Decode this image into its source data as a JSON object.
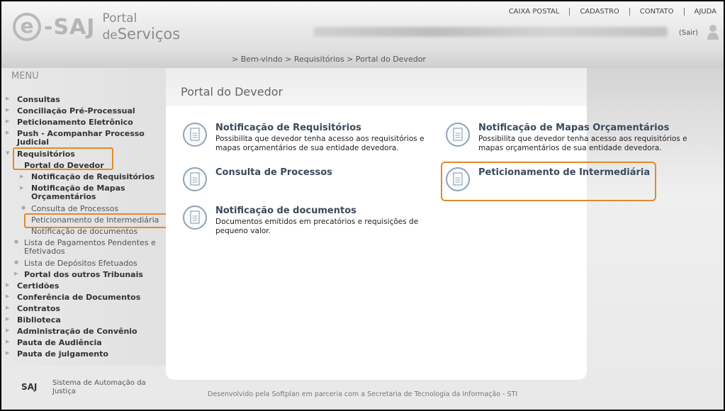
{
  "header": {
    "logo_e": "e",
    "logo_saj": "-SAJ",
    "portal_l1": "Portal",
    "portal_de": "de",
    "portal_servicos": "Serviços",
    "topnav": [
      "CAIXA POSTAL",
      "CADASTRO",
      "CONTATO",
      "AJUDA"
    ],
    "sair": "(Sair)",
    "user_icon": "person-icon"
  },
  "breadcrumb": "> Bem-vindo > Requisitórios > Portal do Devedor",
  "menu": {
    "title": "MENU",
    "items": [
      {
        "label": "Consultas"
      },
      {
        "label": "Conciliação Pré-Processual"
      },
      {
        "label": "Peticionamento Eletrônico"
      },
      {
        "label": "Push - Acompanhar Processo Judicial"
      },
      {
        "label": "Requisitórios"
      },
      {
        "label": "Portal do Devedor"
      },
      {
        "label": "Notificação de Requisitórios"
      },
      {
        "label": "Notificação de Mapas Orçamentários"
      },
      {
        "label": "Consulta de Processos"
      },
      {
        "label": "Peticionamento de Intermediária"
      },
      {
        "label": "Notificação de documentos"
      },
      {
        "label": "Lista de Pagamentos Pendentes e Efetivados"
      },
      {
        "label": "Lista de Depósitos Efetuados"
      },
      {
        "label": "Portal dos outros Tribunais"
      },
      {
        "label": "Certidões"
      },
      {
        "label": "Conferência de Documentos"
      },
      {
        "label": "Contratos"
      },
      {
        "label": "Biblioteca"
      },
      {
        "label": "Administração de Convênio"
      },
      {
        "label": "Pauta de Audiência"
      },
      {
        "label": "Pauta de julgamento"
      }
    ]
  },
  "page_title": "Portal do Devedor",
  "cards": [
    {
      "title": "Notificação de Requisitórios",
      "desc": "Possibilita que devedor tenha acesso aos requisitórios e mapas orçamentários de sua entidade devedora.",
      "icon": "document-icon"
    },
    {
      "title": "Notificação de Mapas Orçamentários",
      "desc": "Possibilita que devedor tenha acesso aos requisitórios e mapas orçamentários de sua entidade devedora.",
      "icon": "document-icon"
    },
    {
      "title": "Consulta de Processos",
      "desc": "",
      "icon": "document-icon"
    },
    {
      "title": "Peticionamento de Intermediária",
      "desc": "",
      "icon": "document-icon"
    },
    {
      "title": "Notificação de documentos",
      "desc": "Documentos emitidos em precatórios e requisições de pequeno valor.",
      "icon": "document-icon"
    }
  ],
  "footer": {
    "logo": "SAJ",
    "system": "Sistema de Automação da Justiça",
    "developed": "Desenvolvido pela Softplan em parceria com a Secretaria de Tecnologia da Informação - STI"
  },
  "colors": {
    "highlight": "#e08a2e",
    "title": "#3b4a5a"
  }
}
